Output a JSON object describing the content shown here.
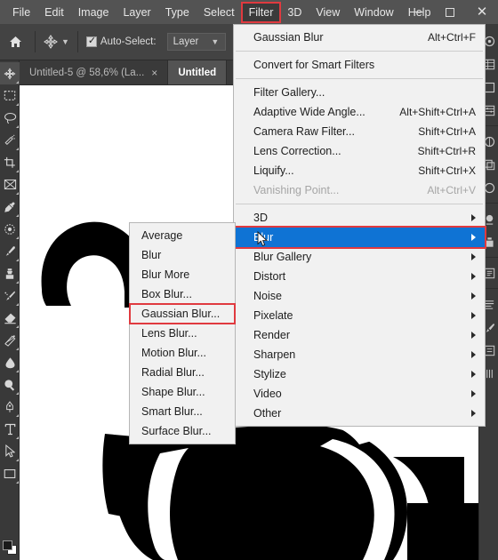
{
  "window": {
    "controls": [
      {
        "name": "minimize",
        "glyph": "minimize-icon"
      },
      {
        "name": "maximize",
        "glyph": "maximize-icon"
      },
      {
        "name": "close",
        "glyph": "close-icon"
      }
    ]
  },
  "menubar": {
    "items": [
      {
        "label": "File",
        "active": false
      },
      {
        "label": "Edit",
        "active": false
      },
      {
        "label": "Image",
        "active": false
      },
      {
        "label": "Layer",
        "active": false
      },
      {
        "label": "Type",
        "active": false
      },
      {
        "label": "Select",
        "active": false
      },
      {
        "label": "Filter",
        "active": true
      },
      {
        "label": "3D",
        "active": false
      },
      {
        "label": "View",
        "active": false
      },
      {
        "label": "Window",
        "active": false
      },
      {
        "label": "Help",
        "active": false
      }
    ]
  },
  "options_bar": {
    "home_icon": "home-icon",
    "tool_icon": "move-tool-icon",
    "tool_caret": "chevron-down-icon",
    "auto_select_label": "Auto-Select:",
    "auto_select_checked": true,
    "layer_select_value": "Layer",
    "layer_select_caret": "chevron-down-icon"
  },
  "tabs": [
    {
      "label": "Untitled-5 @ 58,6% (La...",
      "close": "×",
      "active": false
    },
    {
      "label": "Untitled",
      "close": "×",
      "active": true
    }
  ],
  "toolbar": {
    "tools": [
      {
        "name": "move-tool",
        "selected": true
      },
      {
        "name": "rectangular-marquee-tool",
        "selected": false
      },
      {
        "name": "lasso-tool",
        "selected": false
      },
      {
        "name": "quick-selection-tool",
        "selected": false
      },
      {
        "name": "crop-tool",
        "selected": false
      },
      {
        "name": "frame-tool",
        "selected": false
      },
      {
        "name": "eyedropper-tool",
        "selected": false
      },
      {
        "name": "spot-healing-brush-tool",
        "selected": false
      },
      {
        "name": "brush-tool",
        "selected": false
      },
      {
        "name": "clone-stamp-tool",
        "selected": false
      },
      {
        "name": "history-brush-tool",
        "selected": false
      },
      {
        "name": "eraser-tool",
        "selected": false
      },
      {
        "name": "gradient-tool",
        "selected": false
      },
      {
        "name": "blur-tool",
        "selected": false
      },
      {
        "name": "dodge-tool",
        "selected": false
      },
      {
        "name": "pen-tool",
        "selected": false
      },
      {
        "name": "type-tool",
        "selected": false
      },
      {
        "name": "path-selection-tool",
        "selected": false
      },
      {
        "name": "rectangle-tool",
        "selected": false
      }
    ]
  },
  "right_dock": {
    "icons": [
      "color-panel-icon",
      "swatches-panel-icon",
      "properties-panel-icon",
      "adjustments-panel-icon",
      "libraries-panel-icon",
      "layers-panel-icon",
      "channels-panel-icon",
      "paths-panel-icon",
      "history-panel-icon",
      "character-panel-icon"
    ]
  },
  "filter_menu": {
    "groups": [
      {
        "rows": [
          {
            "label": "Gaussian Blur",
            "accel": "Alt+Ctrl+F",
            "submenu": false,
            "disabled": false,
            "highlighted": false
          }
        ]
      },
      {
        "rows": [
          {
            "label": "Convert for Smart Filters",
            "accel": "",
            "submenu": false,
            "disabled": false,
            "highlighted": false
          }
        ]
      },
      {
        "rows": [
          {
            "label": "Filter Gallery...",
            "accel": "",
            "submenu": false,
            "disabled": false,
            "highlighted": false
          },
          {
            "label": "Adaptive Wide Angle...",
            "accel": "Alt+Shift+Ctrl+A",
            "submenu": false,
            "disabled": false,
            "highlighted": false
          },
          {
            "label": "Camera Raw Filter...",
            "accel": "Shift+Ctrl+A",
            "submenu": false,
            "disabled": false,
            "highlighted": false
          },
          {
            "label": "Lens Correction...",
            "accel": "Shift+Ctrl+R",
            "submenu": false,
            "disabled": false,
            "highlighted": false
          },
          {
            "label": "Liquify...",
            "accel": "Shift+Ctrl+X",
            "submenu": false,
            "disabled": false,
            "highlighted": false
          },
          {
            "label": "Vanishing Point...",
            "accel": "Alt+Ctrl+V",
            "submenu": false,
            "disabled": true,
            "highlighted": false
          }
        ]
      },
      {
        "rows": [
          {
            "label": "3D",
            "accel": "",
            "submenu": true,
            "disabled": false,
            "highlighted": false
          },
          {
            "label": "Blur",
            "accel": "",
            "submenu": true,
            "disabled": false,
            "highlighted": true
          },
          {
            "label": "Blur Gallery",
            "accel": "",
            "submenu": true,
            "disabled": false,
            "highlighted": false
          },
          {
            "label": "Distort",
            "accel": "",
            "submenu": true,
            "disabled": false,
            "highlighted": false
          },
          {
            "label": "Noise",
            "accel": "",
            "submenu": true,
            "disabled": false,
            "highlighted": false
          },
          {
            "label": "Pixelate",
            "accel": "",
            "submenu": true,
            "disabled": false,
            "highlighted": false
          },
          {
            "label": "Render",
            "accel": "",
            "submenu": true,
            "disabled": false,
            "highlighted": false
          },
          {
            "label": "Sharpen",
            "accel": "",
            "submenu": true,
            "disabled": false,
            "highlighted": false
          },
          {
            "label": "Stylize",
            "accel": "",
            "submenu": true,
            "disabled": false,
            "highlighted": false
          },
          {
            "label": "Video",
            "accel": "",
            "submenu": true,
            "disabled": false,
            "highlighted": false
          },
          {
            "label": "Other",
            "accel": "",
            "submenu": true,
            "disabled": false,
            "highlighted": false
          }
        ]
      }
    ]
  },
  "blur_submenu": {
    "items": [
      {
        "label": "Average",
        "boxed": false
      },
      {
        "label": "Blur",
        "boxed": false
      },
      {
        "label": "Blur More",
        "boxed": false
      },
      {
        "label": "Box Blur...",
        "boxed": false
      },
      {
        "label": "Gaussian Blur...",
        "boxed": true
      },
      {
        "label": "Lens Blur...",
        "boxed": false
      },
      {
        "label": "Motion Blur...",
        "boxed": false
      },
      {
        "label": "Radial Blur...",
        "boxed": false
      },
      {
        "label": "Shape Blur...",
        "boxed": false
      },
      {
        "label": "Smart Blur...",
        "boxed": false
      },
      {
        "label": "Surface Blur...",
        "boxed": false
      }
    ]
  },
  "canvas": {
    "artwork_name": "black-silhouette-artwork",
    "background_color": "#ffffff",
    "artwork_color": "#000000"
  },
  "colors": {
    "menubar_bg": "#535353",
    "optionsbar_bg": "#434343",
    "panel_bg": "#393939",
    "menu_bg": "#f1f1f1",
    "highlight_blue": "#0f73d4",
    "annotation_red": "#e03a3f",
    "text_light": "#e8e8e8",
    "text_dark": "#1d1d1d"
  }
}
